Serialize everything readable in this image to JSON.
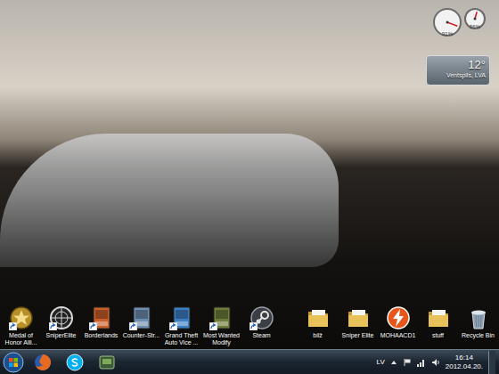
{
  "desktop": {
    "icons": [
      {
        "label": "Medal of Honor Alli...",
        "kind": "medal",
        "shortcut": true,
        "color": "#b8902a"
      },
      {
        "label": "SniperElite",
        "kind": "scope",
        "shortcut": true,
        "color": "#d9d9d9"
      },
      {
        "label": "Borderlands",
        "kind": "game",
        "shortcut": true,
        "color": "#c9602a"
      },
      {
        "label": "Counter-Str...",
        "kind": "game",
        "shortcut": true,
        "color": "#6f8fb0"
      },
      {
        "label": "Grand Theft Auto Vice ...",
        "kind": "game",
        "shortcut": true,
        "color": "#3e7fc4"
      },
      {
        "label": "Most Wanted Modify",
        "kind": "game",
        "shortcut": true,
        "color": "#6e7d3a"
      },
      {
        "label": "Steam",
        "kind": "steam",
        "shortcut": true,
        "color": "#3b3f45"
      },
      {
        "label": "bilž",
        "kind": "folder",
        "shortcut": false,
        "color": "#e8c15a"
      },
      {
        "label": "Sniper Elite",
        "kind": "folder",
        "shortcut": false,
        "color": "#e8c15a"
      },
      {
        "label": "MOHAACD1",
        "kind": "flash",
        "shortcut": false,
        "color": "#e8561c"
      },
      {
        "label": "stuff",
        "kind": "folder",
        "shortcut": false,
        "color": "#e8c15a"
      },
      {
        "label": "Recycle Bin",
        "kind": "recycle",
        "shortcut": false,
        "color": "#9fb4c8"
      }
    ]
  },
  "gadgets": {
    "cpu_meter": {
      "dials": [
        {
          "reading": "91%",
          "level": 0.91
        },
        {
          "reading": "56%",
          "level": 0.56
        }
      ]
    },
    "weather": {
      "temperature": "12°",
      "location": "Ventspils, LVA"
    }
  },
  "taskbar": {
    "pinned": [
      {
        "kind": "start"
      },
      {
        "kind": "firefox"
      },
      {
        "kind": "skype"
      },
      {
        "kind": "app"
      }
    ],
    "tray": {
      "language": "LV",
      "time": "16:14",
      "date": "2012.04.20."
    }
  }
}
